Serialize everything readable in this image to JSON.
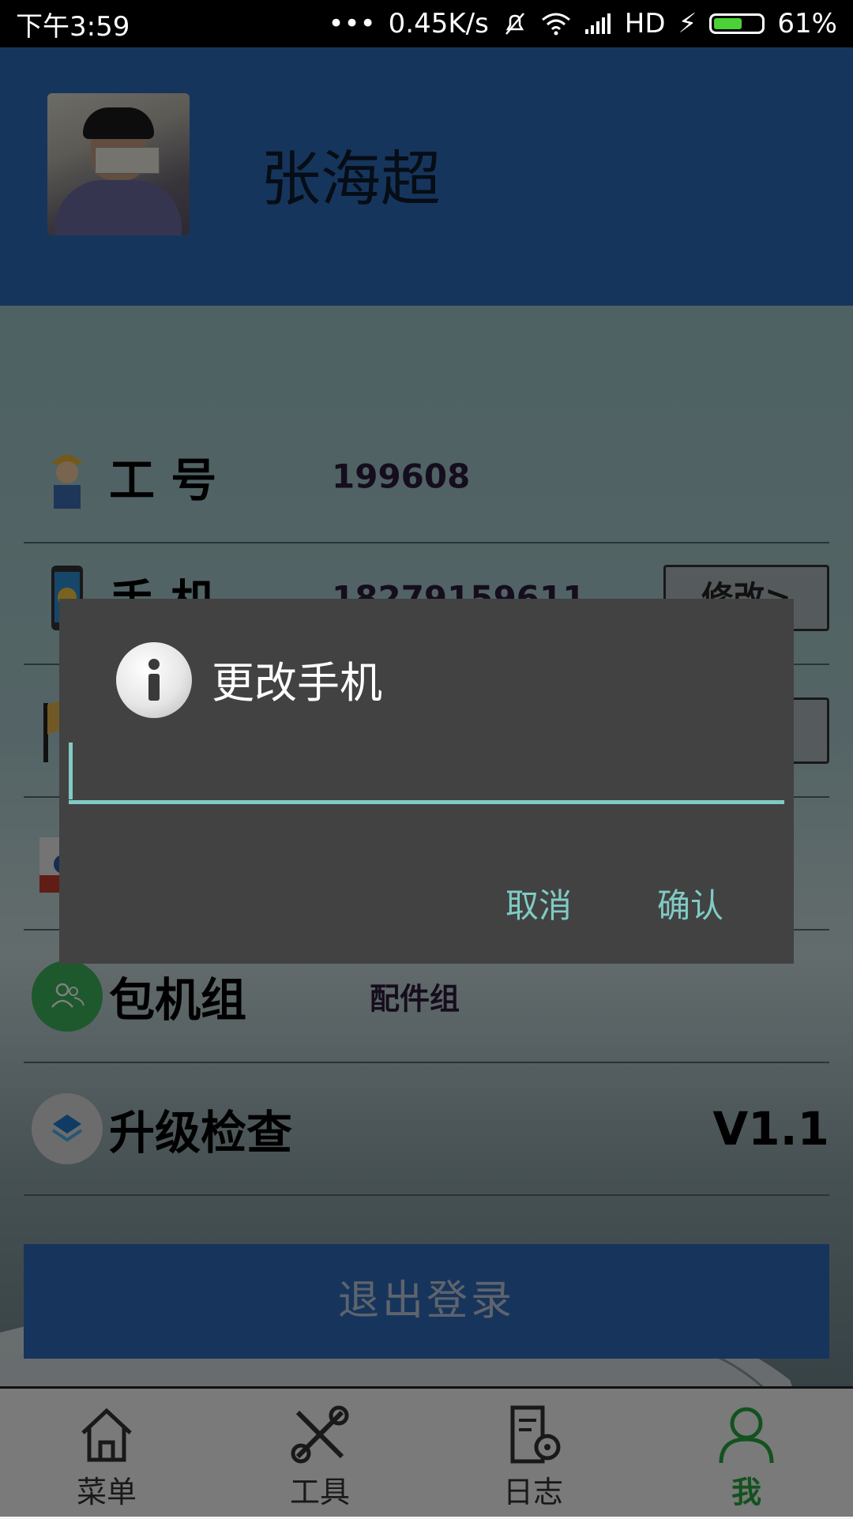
{
  "status_bar": {
    "time": "下午3:59",
    "network_speed": "0.45K/s",
    "network_type": "HD",
    "battery": "61%",
    "battery_level": 0.61
  },
  "profile": {
    "name": "张海超"
  },
  "rows": [
    {
      "label": "工 号",
      "value": "199608",
      "icon": "worker-icon"
    },
    {
      "label": "手 机",
      "value": "18279159611",
      "icon": "phone-icon",
      "button": "修改>"
    },
    {
      "label": "",
      "value": "",
      "icon": "flag-icon",
      "button": ""
    },
    {
      "label": "",
      "value": "",
      "icon": "card-icon"
    },
    {
      "label": "包机组",
      "value": "配件组",
      "icon": "group-icon"
    },
    {
      "label": "升级检查",
      "value": "V1.1",
      "icon": "upgrade-icon"
    }
  ],
  "logout_label": "退出登录",
  "bottom_nav": [
    {
      "label": "菜单",
      "icon": "home-icon"
    },
    {
      "label": "工具",
      "icon": "tools-icon"
    },
    {
      "label": "日志",
      "icon": "log-icon"
    },
    {
      "label": "我",
      "icon": "person-icon",
      "active": true
    }
  ],
  "dialog": {
    "title": "更改手机",
    "input_value": "",
    "cancel_label": "取消",
    "confirm_label": "确认"
  },
  "colors": {
    "header": "#2d6bb8",
    "accent": "#80cbc4",
    "active_nav": "#26a53f",
    "dialog_bg": "#424242"
  }
}
